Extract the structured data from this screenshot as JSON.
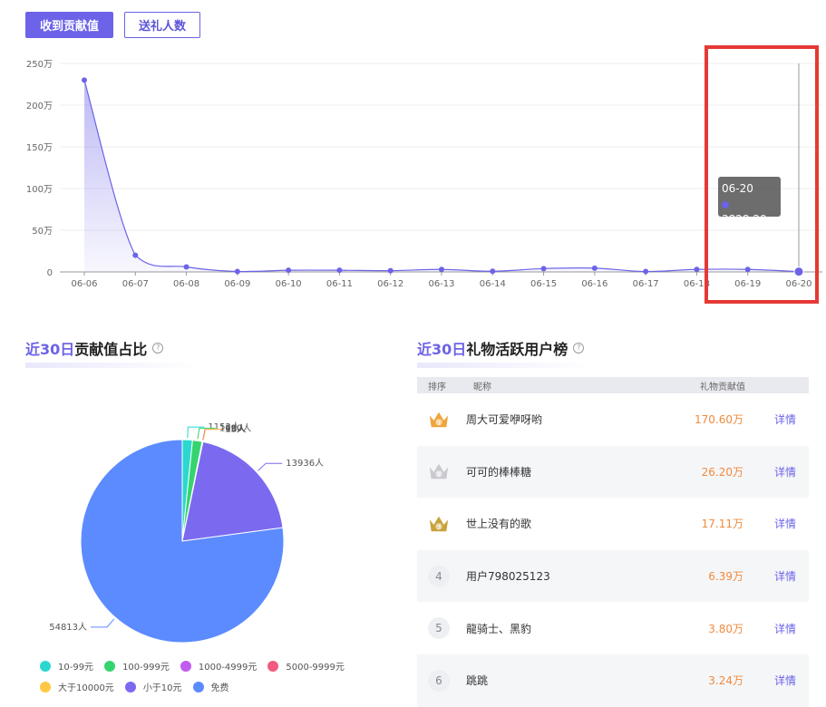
{
  "tabs": [
    {
      "label": "收到贡献值",
      "active": true
    },
    {
      "label": "送礼人数",
      "active": false
    }
  ],
  "chart_data": [
    {
      "type": "area",
      "x": [
        "06-06",
        "06-07",
        "06-08",
        "06-09",
        "06-10",
        "06-11",
        "06-12",
        "06-13",
        "06-14",
        "06-15",
        "06-16",
        "06-17",
        "06-18",
        "06-19",
        "06-20"
      ],
      "values": [
        2300000,
        200000,
        60000,
        5000,
        20000,
        20000,
        15000,
        30000,
        8000,
        40000,
        45000,
        5000,
        30000,
        30000,
        3828.2
      ],
      "yticks": [
        "0",
        "50万",
        "100万",
        "150万",
        "200万",
        "250万"
      ],
      "ylim": [
        0,
        2500000
      ],
      "grid": true,
      "color": "#6c63e8",
      "tooltip": {
        "x": "06-20",
        "value": "3828.20"
      }
    },
    {
      "type": "pie",
      "slices": [
        {
          "name": "10-99元",
          "label": "1152人",
          "value": 1152,
          "color": "#2ad8cf"
        },
        {
          "name": "100-999元",
          "label": "1090人",
          "value": 1090,
          "color": "#36d46f"
        },
        {
          "name": "1000-4999元",
          "label": "55人",
          "value": 55,
          "color": "#c05cf0"
        },
        {
          "name": "5000-9999元",
          "label": "13人",
          "value": 13,
          "color": "#f35a7f"
        },
        {
          "name": "大于10000元",
          "label": "16人",
          "value": 16,
          "color": "#ffc844"
        },
        {
          "name": "小于10元",
          "label": "13936人",
          "value": 13936,
          "color": "#7b6af0"
        },
        {
          "name": "免费",
          "label": "54813人",
          "value": 54813,
          "color": "#5b8bff"
        }
      ]
    }
  ],
  "sections": {
    "pie_title_hl": "近30日",
    "pie_title": "贡献值占比",
    "rank_title_hl": "近30日",
    "rank_title": "礼物活跃用户榜"
  },
  "table": {
    "headers": {
      "rank": "排序",
      "nick": "昵称",
      "value": "礼物贡献值"
    },
    "rows": [
      {
        "rank": "1",
        "nick": "周大可爱咿呀哟",
        "value": "170.60万",
        "detail": "详情",
        "crown": "gold"
      },
      {
        "rank": "2",
        "nick": "可可的棒棒糖",
        "value": "26.20万",
        "detail": "详情",
        "crown": "silver"
      },
      {
        "rank": "3",
        "nick": "世上没有的歌",
        "value": "17.11万",
        "detail": "详情",
        "crown": "bronze"
      },
      {
        "rank": "4",
        "nick": "用户798025123",
        "value": "6.39万",
        "detail": "详情"
      },
      {
        "rank": "5",
        "nick": "龍骑士、黑豹",
        "value": "3.80万",
        "detail": "详情"
      },
      {
        "rank": "6",
        "nick": "跳跳",
        "value": "3.24万",
        "detail": "详情"
      }
    ]
  },
  "colors": {
    "accent": "#6c63e8",
    "value": "#f08a3c",
    "highlight": "#e53935"
  }
}
